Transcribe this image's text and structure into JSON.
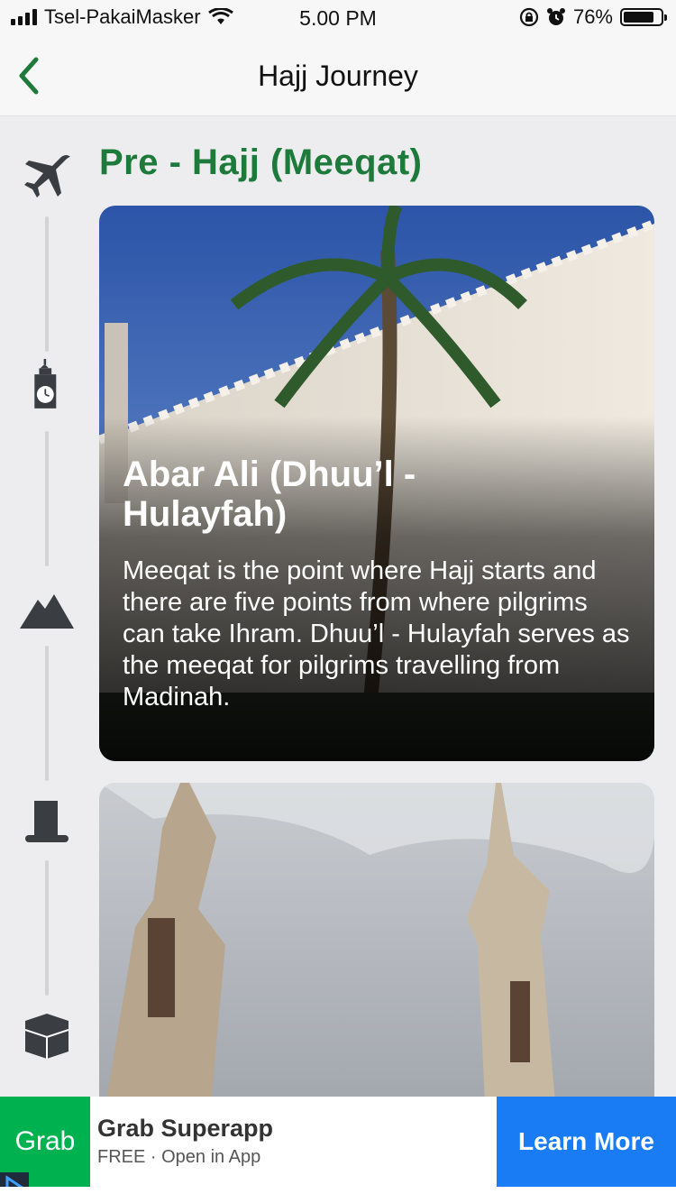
{
  "status_bar": {
    "carrier": "Tsel-PakaiMasker",
    "time": "5.00 PM",
    "battery_percent": "76%",
    "battery_level": 0.76
  },
  "nav": {
    "title": "Hajj Journey",
    "back_icon": "chevron-left-icon",
    "accent_color": "#1e7a3a"
  },
  "timeline": {
    "icons": [
      "airplane-icon",
      "clock-tower-icon",
      "mountain-icon",
      "hat-icon",
      "kaaba-icon"
    ]
  },
  "section": {
    "title": "Pre - Hajj (Meeqat)",
    "color": "#1e7a3a"
  },
  "cards": [
    {
      "title": "Abar Ali (Dhuu’l - Hulayfah)",
      "description": "Meeqat is the point where Hajj starts and there are five points from where pilgrims can take Ihram. Dhuu’l - Hulayfah serves as the meeqat for pilgrims travelling from Madinah."
    },
    {
      "title": "",
      "description": ""
    }
  ],
  "ad": {
    "logo_text": "Grab",
    "title": "Grab Superapp",
    "subtitle": "FREE · Open in App",
    "cta": "Learn More",
    "brand_color": "#00b14f",
    "cta_color": "#1a7cf5"
  }
}
